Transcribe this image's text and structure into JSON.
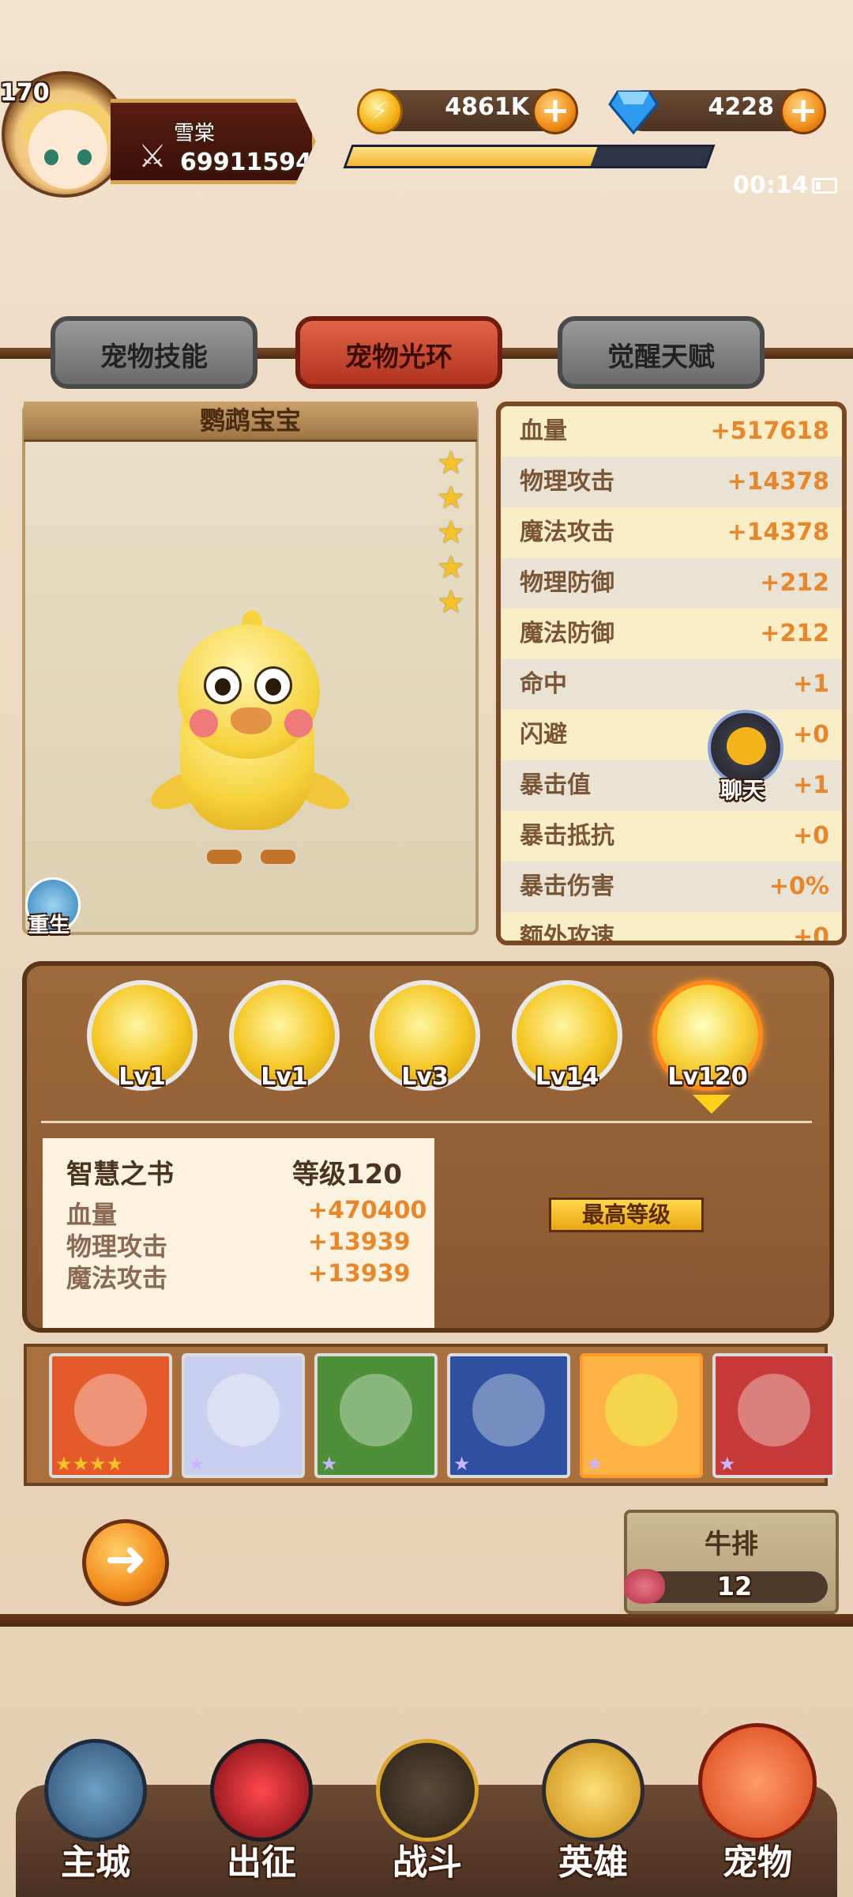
{
  "header": {
    "player_level": "170",
    "player_name": "雪棠",
    "combat_power": "69911594",
    "gold": "4861K",
    "diamonds": "4228",
    "exp_fraction": 0.68,
    "clock": "00:14"
  },
  "tabs": [
    {
      "label": "宠物技能",
      "active": false
    },
    {
      "label": "宠物光环",
      "active": true
    },
    {
      "label": "觉醒天赋",
      "active": false
    }
  ],
  "pet": {
    "name": "鹦鹉宝宝",
    "stars": 5,
    "rebirth_label": "重生"
  },
  "stats": [
    {
      "label": "血量",
      "value": "+517618"
    },
    {
      "label": "物理攻击",
      "value": "+14378"
    },
    {
      "label": "魔法攻击",
      "value": "+14378"
    },
    {
      "label": "物理防御",
      "value": "+212"
    },
    {
      "label": "魔法防御",
      "value": "+212"
    },
    {
      "label": "命中",
      "value": "+1"
    },
    {
      "label": "闪避",
      "value": "+0"
    },
    {
      "label": "暴击值",
      "value": "+1"
    },
    {
      "label": "暴击抵抗",
      "value": "+0"
    },
    {
      "label": "暴击伤害",
      "value": "+0%"
    },
    {
      "label": "额外攻速",
      "value": "+0"
    }
  ],
  "chat_label": "聊天",
  "auras": [
    {
      "level": "Lv1",
      "selected": false
    },
    {
      "level": "Lv1",
      "selected": false
    },
    {
      "level": "Lv3",
      "selected": false
    },
    {
      "level": "Lv14",
      "selected": false
    },
    {
      "level": "Lv120",
      "selected": true
    }
  ],
  "aura_detail": {
    "name": "智慧之书",
    "level": "等级120",
    "stats": [
      {
        "label": "血量",
        "value": "+470400"
      },
      {
        "label": "物理攻击",
        "value": "+13939"
      },
      {
        "label": "魔法攻击",
        "value": "+13939"
      }
    ],
    "max_level_label": "最高等级"
  },
  "pet_list": [
    {
      "icon": "red-dragon",
      "stars": 4,
      "selected": false,
      "color": "#e55a2b"
    },
    {
      "icon": "white-cat",
      "stars": 1,
      "selected": false,
      "color": "#c9cfee"
    },
    {
      "icon": "panda",
      "stars": 1,
      "selected": false,
      "color": "#4e8f3a"
    },
    {
      "icon": "black-dragon",
      "stars": 1,
      "selected": false,
      "color": "#2f4fa0"
    },
    {
      "icon": "yellow-chick",
      "stars": 1,
      "selected": true,
      "color": "#f7d54a"
    },
    {
      "icon": "lion-cub",
      "stars": 1,
      "selected": false,
      "color": "#c83a3a"
    }
  ],
  "steak": {
    "label": "牛排",
    "count": "12"
  },
  "bottom_nav": [
    {
      "label": "主城",
      "icon": "castle-icon"
    },
    {
      "label": "出征",
      "icon": "red-gem-icon"
    },
    {
      "label": "战斗",
      "icon": "crossed-swords-shield-icon"
    },
    {
      "label": "英雄",
      "icon": "golden-helmet-icon"
    },
    {
      "label": "宠物",
      "icon": "dragon-pet-icon"
    }
  ]
}
